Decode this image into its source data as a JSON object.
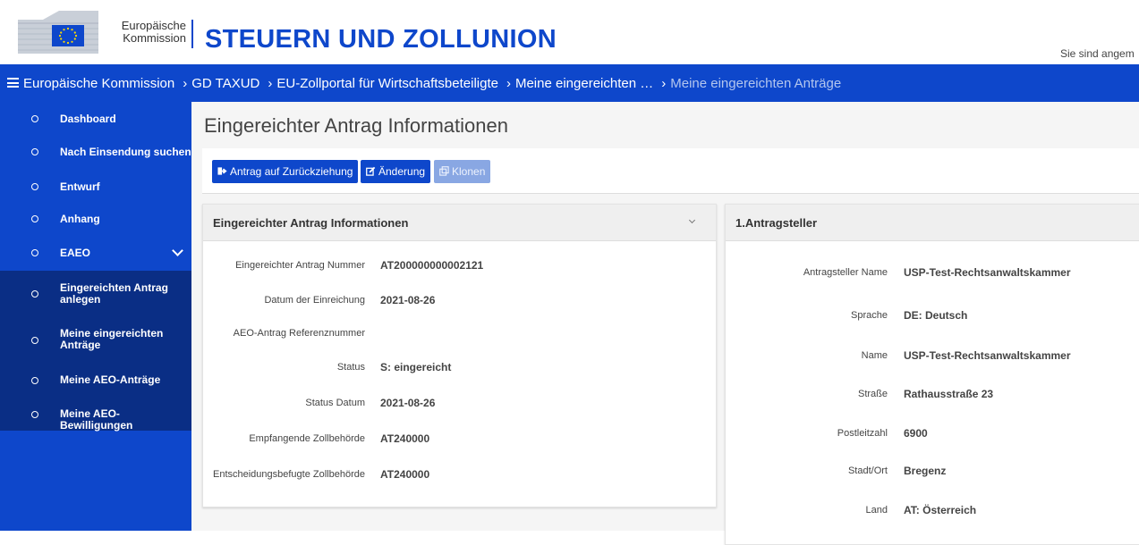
{
  "header": {
    "logo_line1": "Europäische",
    "logo_line2": "Kommission",
    "site_title": "STEUERN UND ZOLLUNION",
    "logged_in_text": "Sie sind angem"
  },
  "breadcrumb": {
    "items": [
      "Europäische Kommission",
      "GD TAXUD",
      "EU-Zollportal für Wirtschaftsbeteiligte",
      "Meine eingereichten …",
      "Meine eingereichten Anträge"
    ]
  },
  "sidebar": {
    "items": [
      {
        "label": "Dashboard"
      },
      {
        "label": "Nach Einsendung suchen"
      },
      {
        "label": "Entwurf"
      },
      {
        "label": "Anhang"
      },
      {
        "label": "EAEO"
      },
      {
        "label_l1": "Eingereichten Antrag",
        "label_l2": "anlegen"
      },
      {
        "label_l1": "Meine eingereichten",
        "label_l2": "Anträge"
      },
      {
        "label": "Meine AEO-Anträge"
      },
      {
        "label": "Meine AEO-Bewilligungen"
      }
    ]
  },
  "page": {
    "title": "Eingereichter Antrag Informationen"
  },
  "toolbar": {
    "withdraw_label": "Antrag auf Zurückziehung",
    "change_label": "Änderung",
    "clone_label": "Klonen"
  },
  "info_card": {
    "title": "Eingereichter Antrag Informationen",
    "fields": [
      {
        "label": "Eingereichter Antrag Nummer",
        "value": "AT200000000002121"
      },
      {
        "label": "Datum der Einreichung",
        "value": "2021-08-26"
      },
      {
        "label": "AEO-Antrag Referenznummer",
        "value": ""
      },
      {
        "label": "Status",
        "value": "S: eingereicht"
      },
      {
        "label": "Status Datum",
        "value": "2021-08-26"
      },
      {
        "label": "Empfangende Zollbehörde",
        "value": "AT240000"
      },
      {
        "label": "Entscheidungsbefugte Zollbehörde",
        "value": "AT240000"
      }
    ]
  },
  "applicant_card": {
    "title": "1.Antragsteller",
    "fields": [
      {
        "label": "Antragsteller Name",
        "value": "USP-Test-Rechtsanwaltskammer"
      },
      {
        "label": "Sprache",
        "value": "DE: Deutsch"
      },
      {
        "label": "Name",
        "value": "USP-Test-Rechtsanwaltskammer"
      },
      {
        "label": "Straße",
        "value": "Rathausstraße 23"
      },
      {
        "label": "Postleitzahl",
        "value": "6900"
      },
      {
        "label": "Stadt/Ort",
        "value": "Bregenz"
      },
      {
        "label": "Land",
        "value": "AT: Österreich"
      }
    ]
  },
  "colors": {
    "brand_blue": "#0e47cb",
    "sidebar_active": "#0a2e85",
    "eu_flag_yellow": "#ffdd00"
  }
}
